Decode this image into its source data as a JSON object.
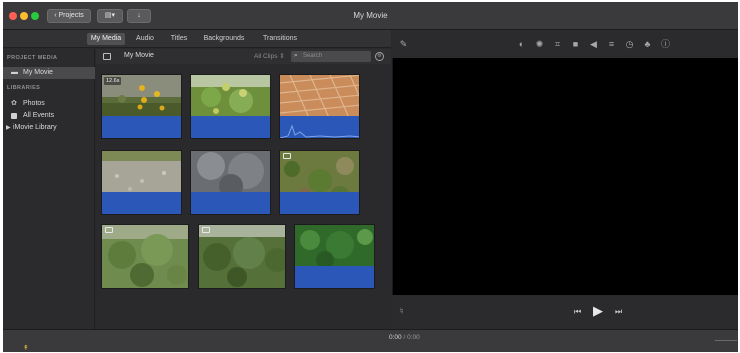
{
  "window": {
    "title": "My Movie",
    "back_button": "Projects"
  },
  "tabs": [
    {
      "label": "My Media",
      "active": true
    },
    {
      "label": "Audio",
      "active": false
    },
    {
      "label": "Titles",
      "active": false
    },
    {
      "label": "Backgrounds",
      "active": false
    },
    {
      "label": "Transitions",
      "active": false
    }
  ],
  "sidebar": {
    "project_media_header": "PROJECT MEDIA",
    "project_item": "My Movie",
    "libraries_header": "LIBRARIES",
    "library_items": [
      "Photos",
      "All Events",
      "iMovie Library"
    ]
  },
  "browser": {
    "event_title": "My Movie",
    "filter": "All Clips",
    "search_placeholder": "Search",
    "clips": [
      {
        "kind": "sunflowers",
        "duration": "12.6s",
        "has_camera": false,
        "audio": "flat"
      },
      {
        "kind": "apple-tree",
        "duration": "",
        "has_camera": false,
        "audio": "flat"
      },
      {
        "kind": "brick",
        "duration": "",
        "has_camera": false,
        "audio": "spiky"
      },
      {
        "kind": "gravel",
        "duration": "",
        "has_camera": false,
        "audio": "flat"
      },
      {
        "kind": "cloud",
        "duration": "",
        "has_camera": false,
        "audio": "flat"
      },
      {
        "kind": "weeds",
        "duration": "",
        "has_camera": true,
        "audio": "flat"
      },
      {
        "kind": "shrubs",
        "duration": "",
        "has_camera": true,
        "audio": "none"
      },
      {
        "kind": "bushes",
        "duration": "",
        "has_camera": true,
        "audio": "none"
      },
      {
        "kind": "leaves",
        "duration": "",
        "has_camera": false,
        "audio": "flat"
      }
    ]
  },
  "viewer": {
    "timecode_current": "0:00",
    "timecode_separator": "/",
    "timecode_total": "0:00"
  },
  "colors": {
    "audio_wave": "#2b57b9",
    "selected": "#4a4a4d",
    "close": "#ff5f57",
    "minimize": "#febc2e",
    "zoom": "#28c840"
  }
}
